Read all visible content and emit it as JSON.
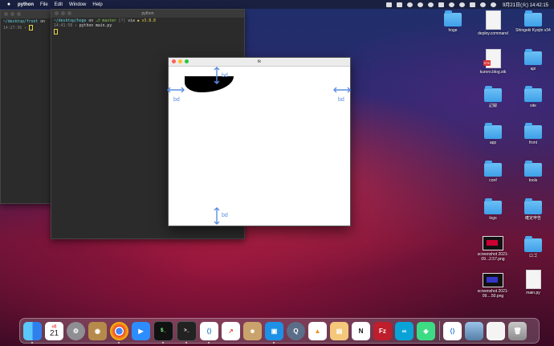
{
  "menubar": {
    "app_name": "python",
    "items": [
      "File",
      "Edit",
      "Window",
      "Help"
    ],
    "status_icons": [
      "screen-icon",
      "battery-icon",
      "p-icon",
      "cloud-icon",
      "audio-icon",
      "bluetooth-icon",
      "wifi-icon",
      "search-icon",
      "control-center-icon",
      "user-icon",
      "siri-icon"
    ],
    "clock": "9月21日(火)  14:42:15"
  },
  "term_back": {
    "prompt_path": "~/desktop/front",
    "prompt_on": "on",
    "time": "14:27:36"
  },
  "term_front": {
    "title": "python",
    "prompt_path": "~/desktop/hoge",
    "prompt_on": "on",
    "branch": "master",
    "flags": "[?]",
    "via": "via",
    "version": "v3.8.8",
    "time": "14:41:58",
    "command": "python main.py"
  },
  "tk_window": {
    "title": "tk",
    "label_top": "bd",
    "label_left": "bd",
    "label_right": "bd",
    "label_bottom": "bd"
  },
  "desktop": {
    "icons": [
      {
        "label": "hoge",
        "kind": "folder"
      },
      {
        "label": "deploy.command",
        "kind": "doc"
      },
      {
        "label": "Shingeki Kyojin v34",
        "kind": "folder"
      },
      {
        "label": "kuroro.blog.stk",
        "kind": "doc"
      },
      {
        "label": "api",
        "kind": "folder"
      },
      {
        "label": "記録",
        "kind": "folder"
      },
      {
        "label": "site",
        "kind": "folder"
      },
      {
        "label": "app",
        "kind": "folder"
      },
      {
        "label": "front",
        "kind": "folder"
      },
      {
        "label": "conf",
        "kind": "folder"
      },
      {
        "label": "tools",
        "kind": "folder"
      },
      {
        "label": "logs",
        "kind": "folder"
      },
      {
        "label": "確定申告",
        "kind": "folder"
      },
      {
        "label": "screenshot 2021-09...2.57.png",
        "kind": "image"
      },
      {
        "label": "ロゴ",
        "kind": "folder"
      },
      {
        "label": "screenshot 2021-09....50.png",
        "kind": "image"
      },
      {
        "label": "main.py",
        "kind": "doc"
      }
    ]
  },
  "dock": {
    "calendar_month": "9月",
    "calendar_day": "21",
    "apps": [
      "finder-icon",
      "calendar-icon",
      "system-preferences-icon",
      "contacts-icon",
      "chrome-icon",
      "zoom-icon",
      "terminal-icon",
      "terminal2-icon",
      "vscode-icon",
      "instruments-icon",
      "cyberduck-icon",
      "docker-icon",
      "quicktime-icon",
      "sourcetree-icon",
      "preview-icon",
      "notion-icon",
      "filezilla-icon",
      "arduino-icon",
      "android-studio-icon",
      "vscode-icon",
      "screenshot-icon",
      "document-icon",
      "trash-icon"
    ]
  }
}
